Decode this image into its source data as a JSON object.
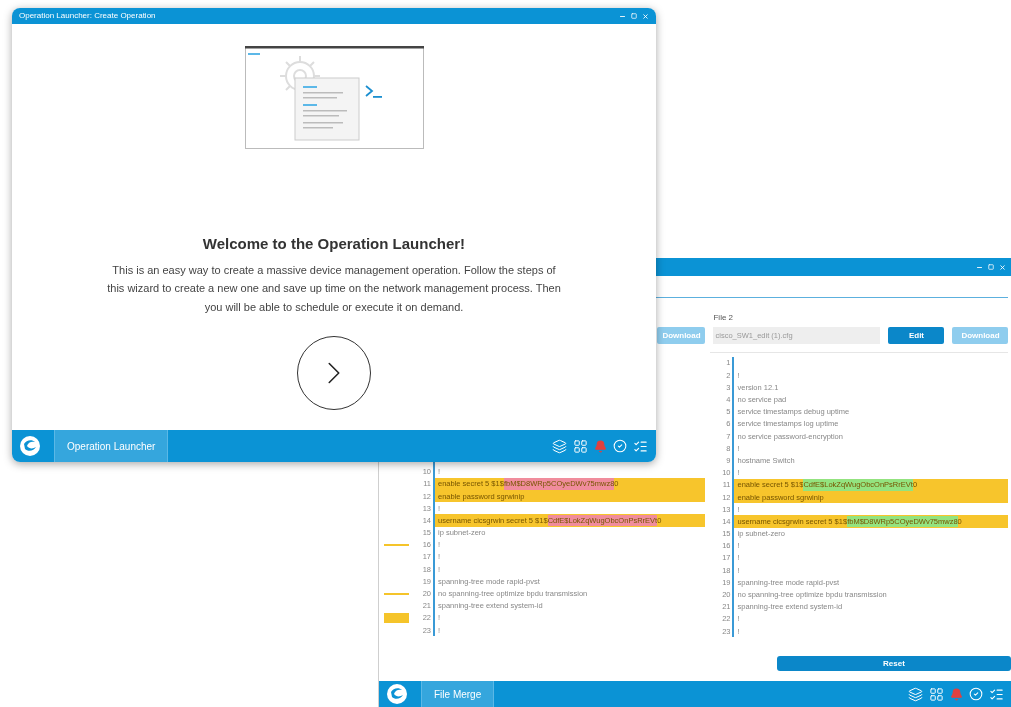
{
  "launcher_window": {
    "title": "Operation Launcher: Create Operation",
    "heading": "Welcome to the Operation Launcher!",
    "description": "This is an easy way to create a massive device management operation. Follow the steps of this wizard to create a new one and save up time on the network management process. Then you will be able to schedule or execute it on demand.",
    "taskbar": {
      "tabs": [
        {
          "label": "Operation Launcher",
          "selected": true
        }
      ]
    }
  },
  "merge_window": {
    "file1": {
      "buttons": [
        {
          "label": "Download",
          "disabled": true
        }
      ]
    },
    "file2": {
      "label": "File 2",
      "filename": "cisco_SW1_edit (1).cfg",
      "buttons": [
        {
          "label": "Edit",
          "disabled": false
        },
        {
          "label": "Download",
          "disabled": true
        }
      ]
    },
    "pane1": {
      "lines": [
        {
          "number": "10",
          "changed": false,
          "segments": [
            {
              "text": "!",
              "kind": "plain"
            }
          ]
        },
        {
          "number": "11",
          "changed": true,
          "segments": [
            {
              "text": "enable secret 5 $1$",
              "kind": "plain"
            },
            {
              "text": "fbM$D8WRp5COyeDWv75mwz8",
              "kind": "removed"
            },
            {
              "text": "0",
              "kind": "plain"
            }
          ]
        },
        {
          "number": "12",
          "changed": true,
          "segments": [
            {
              "text": "enable password sgrwinip",
              "kind": "plain"
            }
          ]
        },
        {
          "number": "13",
          "changed": false,
          "segments": [
            {
              "text": "!",
              "kind": "plain"
            }
          ]
        },
        {
          "number": "14",
          "changed": true,
          "segments": [
            {
              "text": "username cicsgrwin secret 5 $1$",
              "kind": "plain"
            },
            {
              "text": "CdfE$LokZqWugObcOnPsRrEVt",
              "kind": "removed"
            },
            {
              "text": "0",
              "kind": "plain"
            }
          ]
        },
        {
          "number": "15",
          "changed": false,
          "segments": [
            {
              "text": "ip subnet-zero",
              "kind": "plain"
            }
          ]
        },
        {
          "number": "16",
          "changed": false,
          "kind": "bar",
          "segments": [
            {
              "text": "!",
              "kind": "plain"
            }
          ]
        },
        {
          "number": "17",
          "changed": false,
          "segments": [
            {
              "text": "!",
              "kind": "plain"
            }
          ]
        },
        {
          "number": "18",
          "changed": false,
          "segments": [
            {
              "text": "!",
              "kind": "plain"
            }
          ]
        },
        {
          "number": "19",
          "changed": false,
          "segments": [
            {
              "text": "spanning-tree mode rapid-pvst",
              "kind": "plain"
            }
          ]
        },
        {
          "number": "20",
          "changed": false,
          "kind": "bar",
          "segments": [
            {
              "text": "no spanning-tree optimize bpdu transmission",
              "kind": "plain"
            }
          ]
        },
        {
          "number": "21",
          "changed": false,
          "segments": [
            {
              "text": "spanning-tree extend system-id",
              "kind": "plain"
            }
          ]
        },
        {
          "number": "22",
          "changed": false,
          "kind": "block",
          "segments": [
            {
              "text": "!",
              "kind": "plain"
            }
          ]
        },
        {
          "number": "23",
          "changed": false,
          "segments": [
            {
              "text": "!",
              "kind": "plain"
            }
          ]
        }
      ]
    },
    "pane2": {
      "lines": [
        {
          "number": "1",
          "changed": false
        },
        {
          "number": "2",
          "changed": false,
          "segments": [
            {
              "text": "!",
              "kind": "plain"
            }
          ]
        },
        {
          "number": "3",
          "changed": false,
          "segments": [
            {
              "text": "version 12.1",
              "kind": "plain"
            }
          ]
        },
        {
          "number": "4",
          "changed": false,
          "segments": [
            {
              "text": "no service pad",
              "kind": "plain"
            }
          ]
        },
        {
          "number": "5",
          "changed": false,
          "segments": [
            {
              "text": "service timestamps debug uptime",
              "kind": "plain"
            }
          ]
        },
        {
          "number": "6",
          "changed": false,
          "segments": [
            {
              "text": "service timestamps log uptime",
              "kind": "plain"
            }
          ]
        },
        {
          "number": "7",
          "changed": false,
          "segments": [
            {
              "text": "no service password-encryption",
              "kind": "plain"
            }
          ]
        },
        {
          "number": "8",
          "changed": false,
          "segments": [
            {
              "text": "!",
              "kind": "plain"
            }
          ]
        },
        {
          "number": "9",
          "changed": false,
          "segments": [
            {
              "text": "hostname Switch",
              "kind": "plain"
            }
          ]
        },
        {
          "number": "10",
          "changed": false,
          "segments": [
            {
              "text": "!",
              "kind": "plain"
            }
          ]
        },
        {
          "number": "11",
          "changed": true,
          "segments": [
            {
              "text": "enable secret 5 $1$",
              "kind": "plain"
            },
            {
              "text": "CdfE$LokZqWugObcOnPsRrEVt",
              "kind": "added"
            },
            {
              "text": "0",
              "kind": "plain"
            }
          ]
        },
        {
          "number": "12",
          "changed": true,
          "segments": [
            {
              "text": "enable password sgrwinip",
              "kind": "plain"
            }
          ]
        },
        {
          "number": "13",
          "changed": false,
          "segments": [
            {
              "text": "!",
              "kind": "plain"
            }
          ]
        },
        {
          "number": "14",
          "changed": true,
          "segments": [
            {
              "text": "username cicsgrwin secret 5 $1$",
              "kind": "plain"
            },
            {
              "text": "fbM$D8WRp5COyeDWv75mwz8",
              "kind": "added"
            },
            {
              "text": "0",
              "kind": "plain"
            }
          ]
        },
        {
          "number": "15",
          "changed": false,
          "segments": [
            {
              "text": "ip subnet-zero",
              "kind": "plain"
            }
          ]
        },
        {
          "number": "16",
          "changed": false,
          "segments": [
            {
              "text": "!",
              "kind": "plain"
            }
          ]
        },
        {
          "number": "17",
          "changed": false,
          "segments": [
            {
              "text": "!",
              "kind": "plain"
            }
          ]
        },
        {
          "number": "18",
          "changed": false,
          "segments": [
            {
              "text": "!",
              "kind": "plain"
            }
          ]
        },
        {
          "number": "19",
          "changed": false,
          "segments": [
            {
              "text": "spanning-tree mode rapid-pvst",
              "kind": "plain"
            }
          ]
        },
        {
          "number": "20",
          "changed": false,
          "segments": [
            {
              "text": "no spanning-tree optimize bpdu transmission",
              "kind": "plain"
            }
          ]
        },
        {
          "number": "21",
          "changed": false,
          "segments": [
            {
              "text": "spanning-tree extend system-id",
              "kind": "plain"
            }
          ]
        },
        {
          "number": "22",
          "changed": false,
          "segments": [
            {
              "text": "!",
              "kind": "plain"
            }
          ]
        },
        {
          "number": "23",
          "changed": false,
          "segments": [
            {
              "text": "!",
              "kind": "plain"
            }
          ]
        }
      ]
    },
    "reset_button": "Reset",
    "taskbar": {
      "tabs": [
        {
          "label": "File Merge",
          "selected": true
        }
      ]
    }
  }
}
